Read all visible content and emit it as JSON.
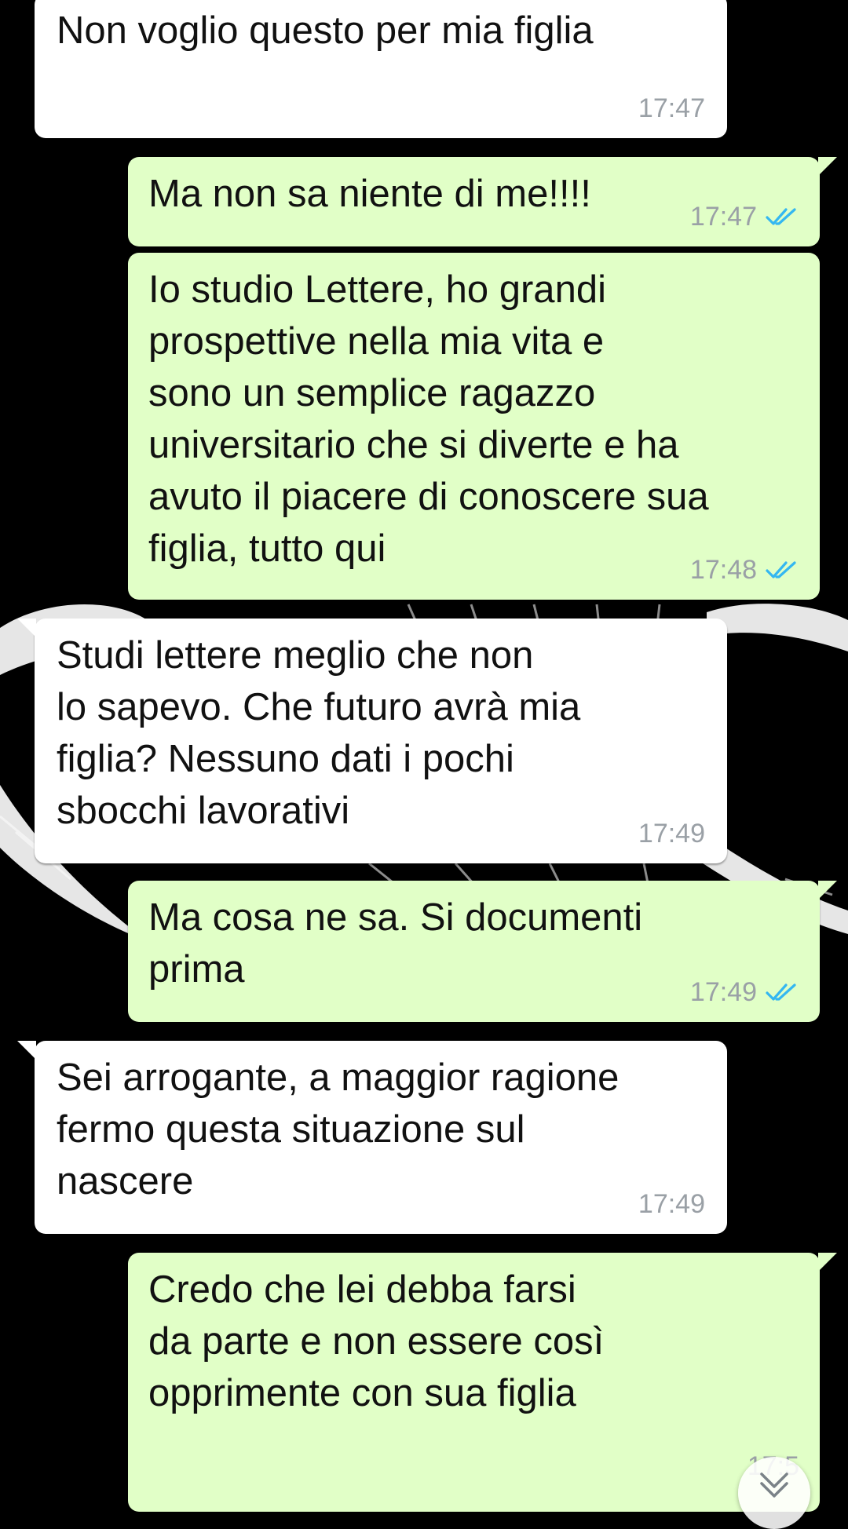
{
  "conversation": {
    "messages": [
      {
        "direction": "incoming",
        "text": "Non voglio questo per mia figlia",
        "time": "17:47"
      },
      {
        "direction": "outgoing",
        "text": "Ma non sa niente di me!!!!",
        "time": "17:47",
        "status": "read"
      },
      {
        "direction": "outgoing",
        "text": "Io studio Lettere, ho grandi\nprospettive nella mia vita e\nsono un semplice ragazzo\nuniversitario che si diverte e ha\navuto il piacere di conoscere sua\nfiglia, tutto qui",
        "time": "17:48",
        "status": "read"
      },
      {
        "direction": "incoming",
        "text": "Studi lettere meglio che non\nlo sapevo. Che futuro avrà mia\nfiglia? Nessuno dati i pochi\nsbocchi lavorativi",
        "time": "17:49"
      },
      {
        "direction": "outgoing",
        "text": "Ma cosa ne sa. Si documenti\nprima",
        "time": "17:49",
        "status": "read"
      },
      {
        "direction": "incoming",
        "text": "Sei arrogante, a maggior ragione\nfermo questa situazione sul\nnascere",
        "time": "17:49"
      },
      {
        "direction": "outgoing",
        "text": "Credo che lei debba farsi\nda parte e non essere così\nopprimente con sua figlia",
        "time": "17:5"
      }
    ]
  },
  "colors": {
    "background": "#000000",
    "incoming_bubble": "#ffffff",
    "outgoing_bubble": "#e1ffc7",
    "read_ticks": "#34b7f1",
    "timestamp": "#9aa0a6"
  },
  "icons": {
    "read_receipt": "double-check-icon",
    "scroll_down": "chevron-down-icon"
  }
}
